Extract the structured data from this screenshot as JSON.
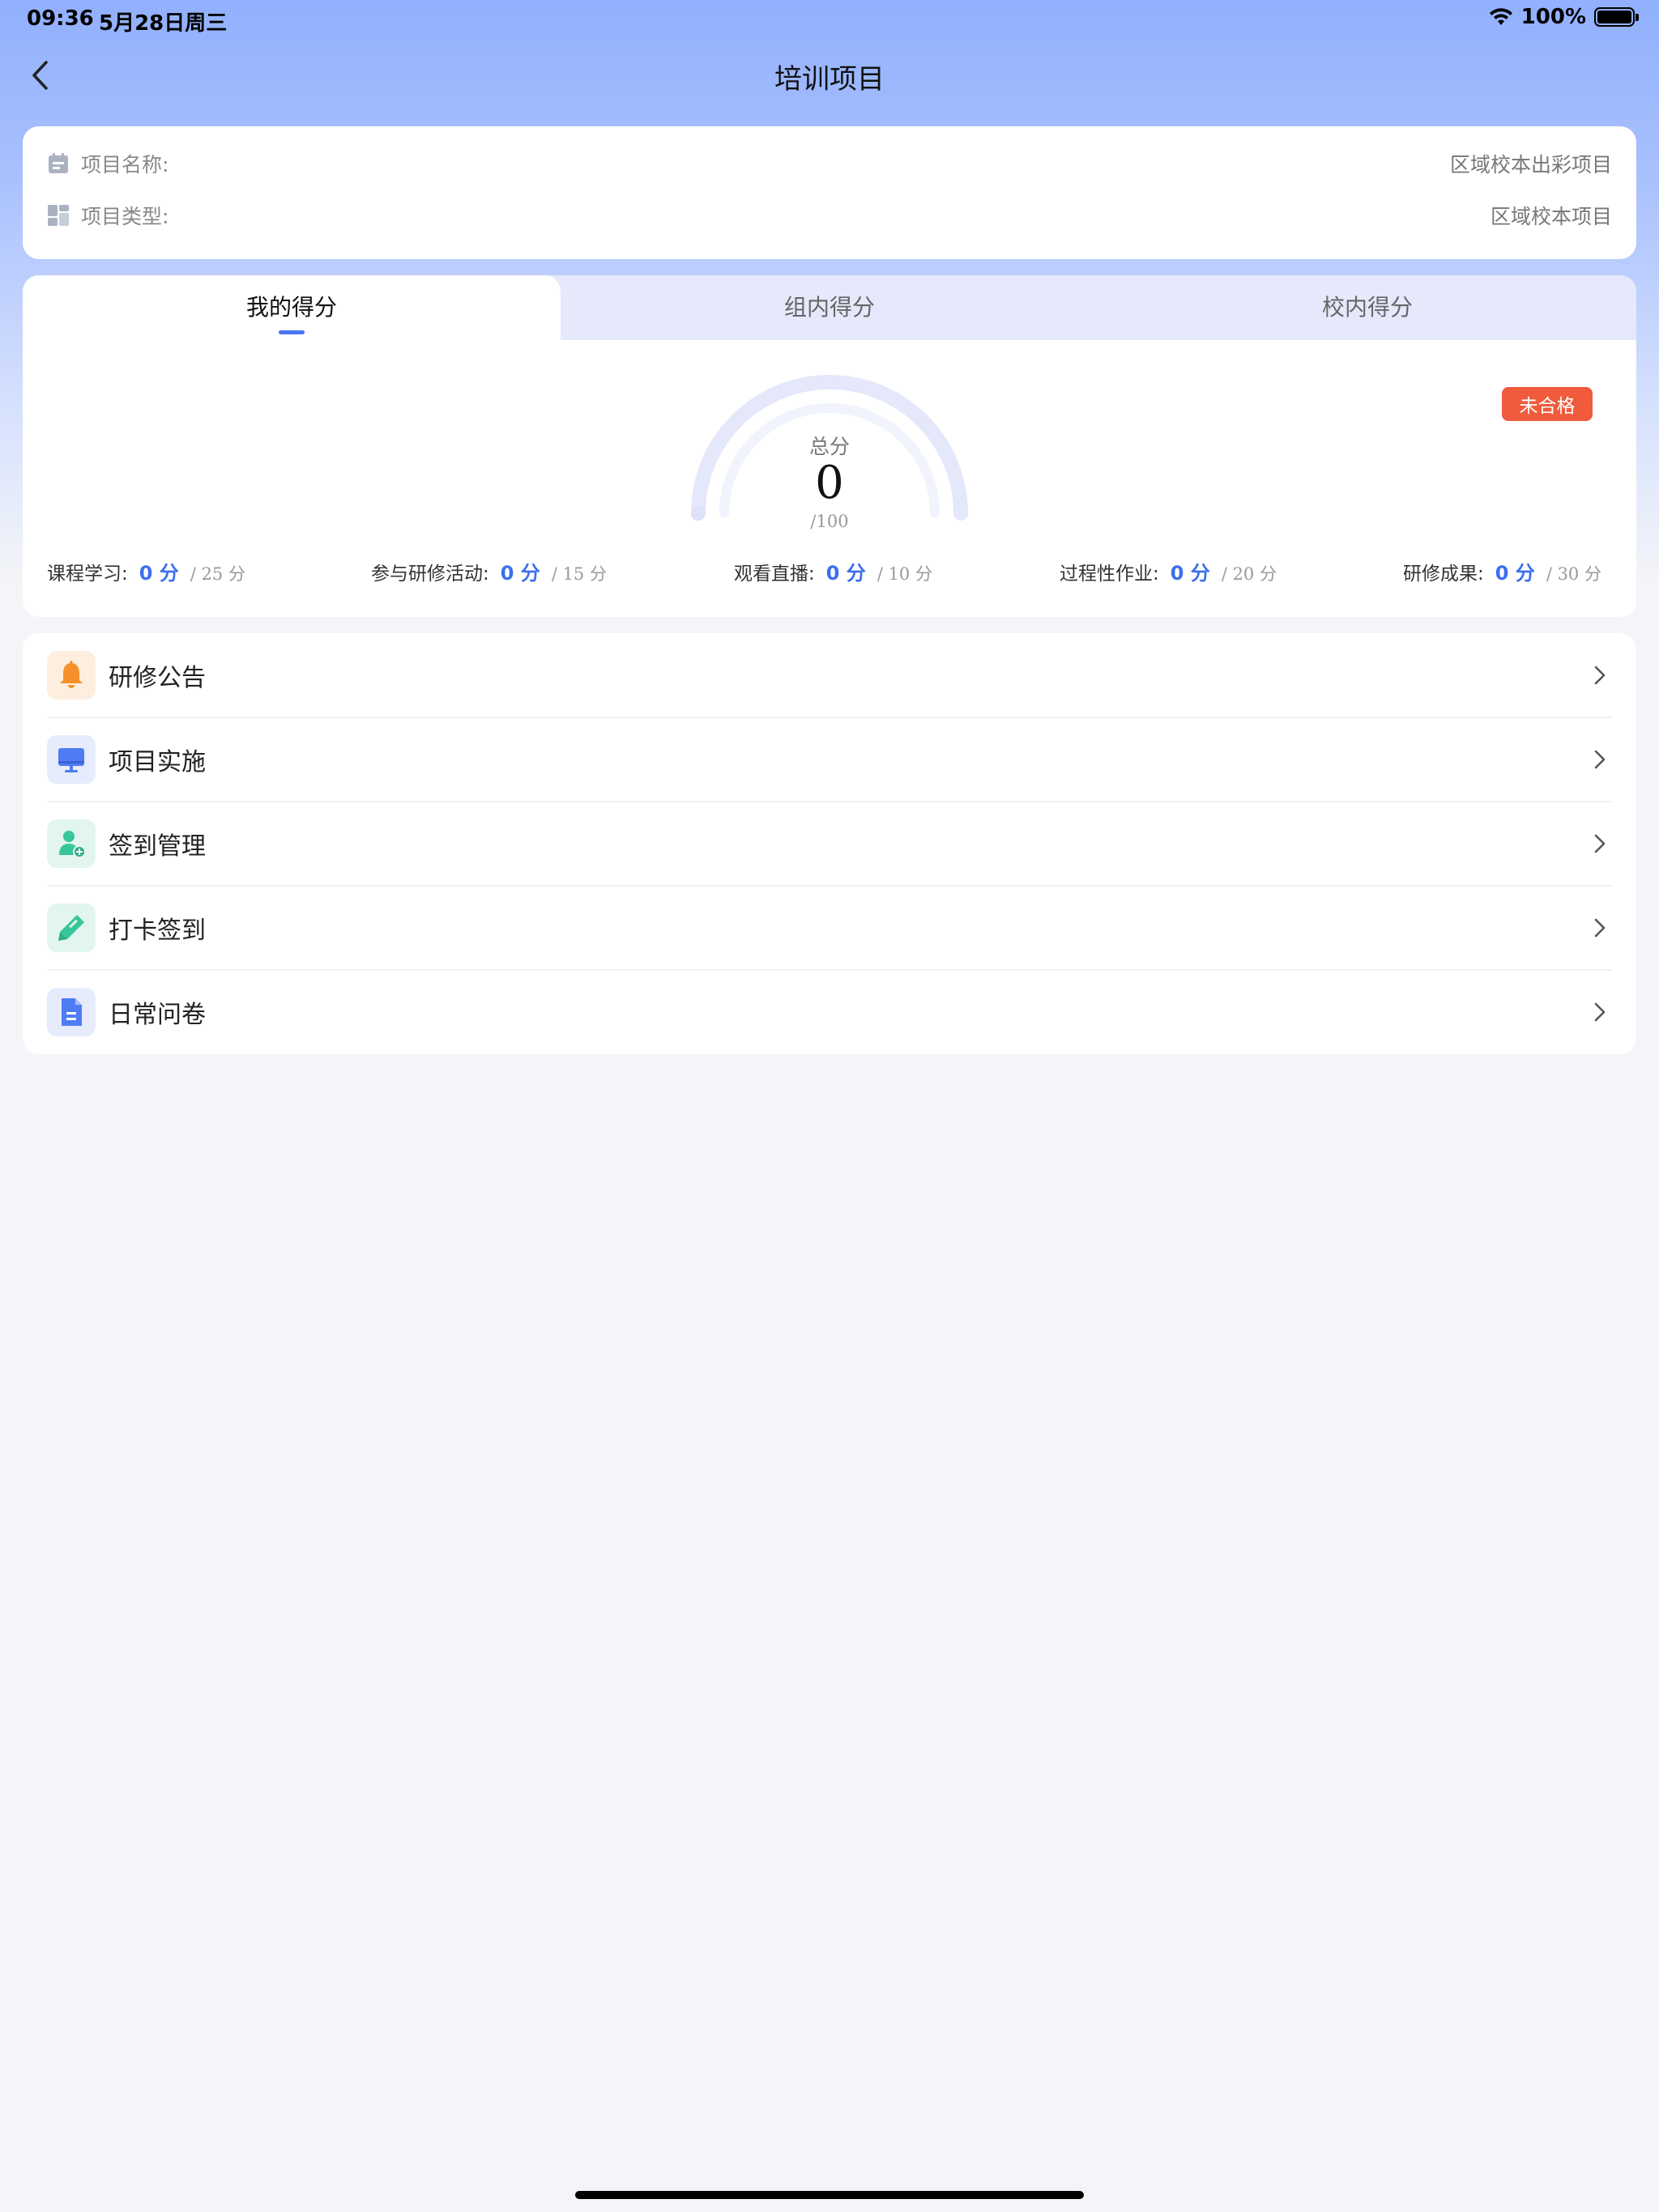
{
  "status_bar": {
    "time": "09:36",
    "date": "5月28日周三",
    "battery": "100%"
  },
  "nav": {
    "title": "培训项目"
  },
  "project_info": {
    "name_label": "项目名称:",
    "name_value": "区域校本出彩项目",
    "type_label": "项目类型:",
    "type_value": "区域校本项目"
  },
  "score_tabs": [
    {
      "label": "我的得分",
      "active": true
    },
    {
      "label": "组内得分",
      "active": false
    },
    {
      "label": "校内得分",
      "active": false
    }
  ],
  "score": {
    "total_label": "总分",
    "total_value": "0",
    "total_max": "/100",
    "status_badge": "未合格",
    "metrics": [
      {
        "label": "课程学习:",
        "value": "0 分",
        "max": "/ 25 分"
      },
      {
        "label": "参与研修活动:",
        "value": "0 分",
        "max": "/ 15 分"
      },
      {
        "label": "观看直播:",
        "value": "0 分",
        "max": "/ 10 分"
      },
      {
        "label": "过程性作业:",
        "value": "0 分",
        "max": "/ 20 分"
      },
      {
        "label": "研修成果:",
        "value": "0 分",
        "max": "/ 30 分"
      }
    ]
  },
  "menu": [
    {
      "label": "研修公告",
      "icon": "bell-icon",
      "color": "#f5902a"
    },
    {
      "label": "项目实施",
      "icon": "monitor-icon",
      "color": "#4f7cf3"
    },
    {
      "label": "签到管理",
      "icon": "user-add-icon",
      "color": "#39c59a"
    },
    {
      "label": "打卡签到",
      "icon": "pencil-icon",
      "color": "#39c59a"
    },
    {
      "label": "日常问卷",
      "icon": "document-icon",
      "color": "#4f7cf3"
    }
  ],
  "colors": {
    "accent": "#4a76f2",
    "badge": "#ef5b3c",
    "header": "#91b0fd"
  }
}
